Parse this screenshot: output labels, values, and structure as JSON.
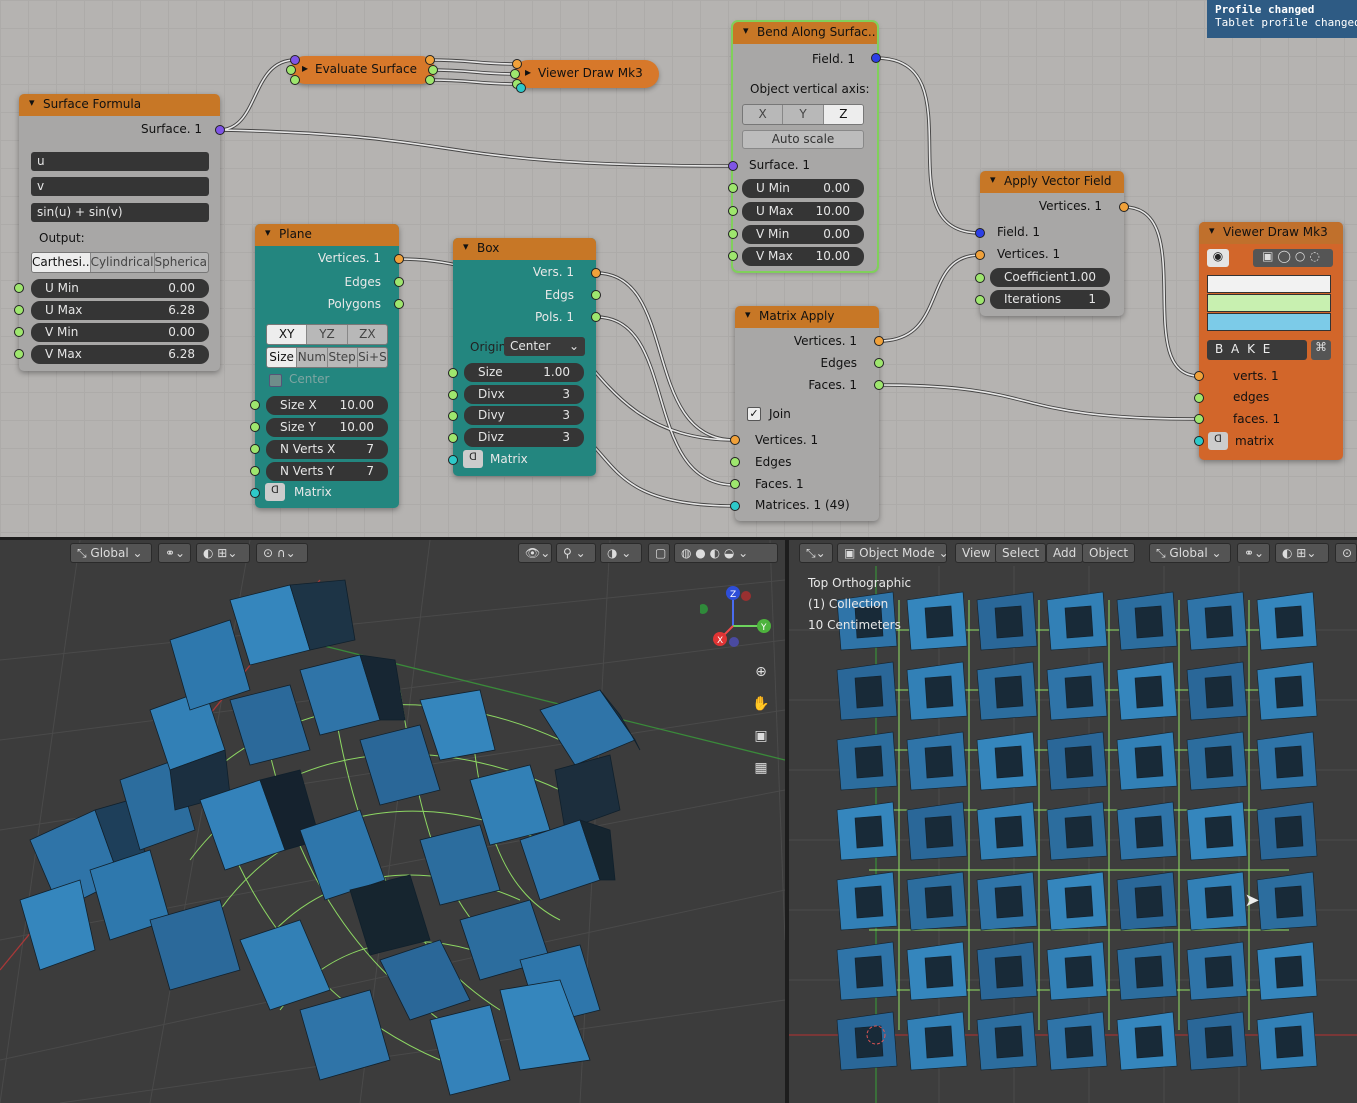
{
  "notification": {
    "title": "Profile changed",
    "message": "Tablet profile changed"
  },
  "nodes": {
    "surface_formula": {
      "title": "Surface Formula",
      "output": "Surface. 1",
      "expr_u": "u",
      "expr_v": "v",
      "expr_z": "sin(u) + sin(v)",
      "output_label": "Output:",
      "modes": [
        "Carthesi..",
        "Cylindrical",
        "Spherical"
      ],
      "fields": [
        {
          "label": "U Min",
          "value": "0.00"
        },
        {
          "label": "U Max",
          "value": "6.28"
        },
        {
          "label": "V Min",
          "value": "0.00"
        },
        {
          "label": "V Max",
          "value": "6.28"
        }
      ]
    },
    "evaluate_surface": {
      "title": "Evaluate Surface"
    },
    "viewer_draw_small": {
      "title": "Viewer Draw Mk3"
    },
    "bend": {
      "title": "Bend Along Surfac..",
      "output": "Field. 1",
      "axis_label": "Object vertical axis:",
      "axes": [
        "X",
        "Y",
        "Z"
      ],
      "auto_scale": "Auto scale",
      "surface_in": "Surface. 1",
      "fields": [
        {
          "label": "U Min",
          "value": "0.00"
        },
        {
          "label": "U Max",
          "value": "10.00"
        },
        {
          "label": "V Min",
          "value": "0.00"
        },
        {
          "label": "V Max",
          "value": "10.00"
        }
      ]
    },
    "plane": {
      "title": "Plane",
      "outputs": [
        "Vertices. 1",
        "Edges",
        "Polygons"
      ],
      "planes": [
        "XY",
        "YZ",
        "ZX"
      ],
      "modes": [
        "Size",
        "Num",
        "Step",
        "Si+S"
      ],
      "center": "Center",
      "fields": [
        {
          "label": "Size X",
          "value": "10.00"
        },
        {
          "label": "Size Y",
          "value": "10.00"
        },
        {
          "label": "N Verts X",
          "value": "7"
        },
        {
          "label": "N Verts Y",
          "value": "7"
        }
      ],
      "matrix": "Matrix"
    },
    "box": {
      "title": "Box",
      "outputs": [
        "Vers. 1",
        "Edgs",
        "Pols. 1"
      ],
      "origin_label": "Origin",
      "origin_value": "Center",
      "fields": [
        {
          "label": "Size",
          "value": "1.00"
        },
        {
          "label": "Divx",
          "value": "3"
        },
        {
          "label": "Divy",
          "value": "3"
        },
        {
          "label": "Divz",
          "value": "3"
        }
      ],
      "matrix": "Matrix"
    },
    "matrix_apply": {
      "title": "Matrix Apply",
      "outputs": [
        "Vertices. 1",
        "Edges",
        "Faces. 1"
      ],
      "join": "Join",
      "inputs": [
        "Vertices. 1",
        "Edges",
        "Faces. 1",
        "Matrices. 1 (49)"
      ]
    },
    "apply_vector_field": {
      "title": "Apply Vector Field",
      "output": "Vertices. 1",
      "inputs": [
        "Field. 1",
        "Vertices. 1"
      ],
      "fields": [
        {
          "label": "Coefficient",
          "value": "1.00"
        },
        {
          "label": "Iterations",
          "value": "1"
        }
      ]
    },
    "viewer_draw": {
      "title": "Viewer Draw Mk3",
      "bake": "B A K E",
      "inputs": [
        "verts. 1",
        "edges",
        "faces. 1",
        "matrix"
      ],
      "colors": [
        "#f2f2f2",
        "#c8f0b0",
        "#7ccbe8"
      ]
    }
  },
  "viewport_left": {
    "orientation": "Global"
  },
  "viewport_right": {
    "mode": "Object Mode",
    "menu": [
      "View",
      "Select",
      "Add",
      "Object"
    ],
    "orientation": "Global",
    "view_name": "Top Orthographic",
    "collection": "(1) Collection",
    "scale": "10 Centimeters"
  },
  "colors": {
    "node_bg": "#a8a7a6",
    "header_orange": "#c77726",
    "teal": "#23867f",
    "cube_blue": "#2f74a8",
    "wire_green": "#9cf36a"
  }
}
